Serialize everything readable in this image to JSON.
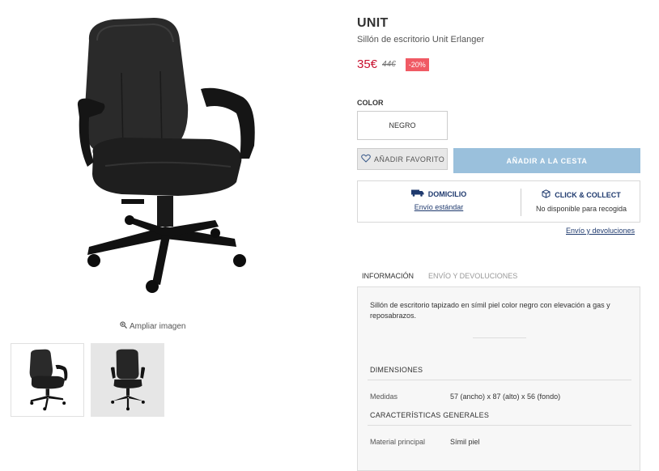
{
  "product": {
    "brand": "UNIT",
    "subtitle": "Sillón de escritorio Unit Erlanger",
    "price": "35€",
    "old_price": "44€",
    "discount": "-20%"
  },
  "gallery": {
    "zoom_label": "Ampliar imagen",
    "zoom_icon": "zoom-in-icon"
  },
  "color": {
    "label": "COLOR",
    "selected": "NEGRO"
  },
  "actions": {
    "favorite_label": "AÑADIR FAVORITO",
    "favorite_icon": "heart-icon",
    "cart_label": "AÑADIR A LA CESTA"
  },
  "delivery": {
    "home_title": "DOMICILIO",
    "home_icon": "truck-icon",
    "home_link": "Envío estándar",
    "collect_title": "CLICK & COLLECT",
    "collect_icon": "box-icon",
    "collect_text": "No disponible para recogida",
    "shipping_link": "Envío y devoluciones"
  },
  "tabs": [
    {
      "label": "INFORMACIÓN",
      "active": true
    },
    {
      "label": "ENVÍO Y DEVOLUCIONES",
      "active": false
    }
  ],
  "info": {
    "description": "Sillón de escritorio tapizado en símil piel color negro con elevación a gas y reposabrazos.",
    "dimensions_title": "DIMENSIONES",
    "dim_key": "Medidas",
    "dim_value": "57 (ancho) x 87 (alto) x 56 (fondo)",
    "features_title": "CARACTERÍSTICAS GENERALES",
    "material_key": "Material principal",
    "material_value": "Símil piel"
  },
  "colors": {
    "accent_price": "#c8102e",
    "discount_bg": "#f05a64",
    "cart_button": "#9ac0dc",
    "link": "#1f3a6e"
  }
}
